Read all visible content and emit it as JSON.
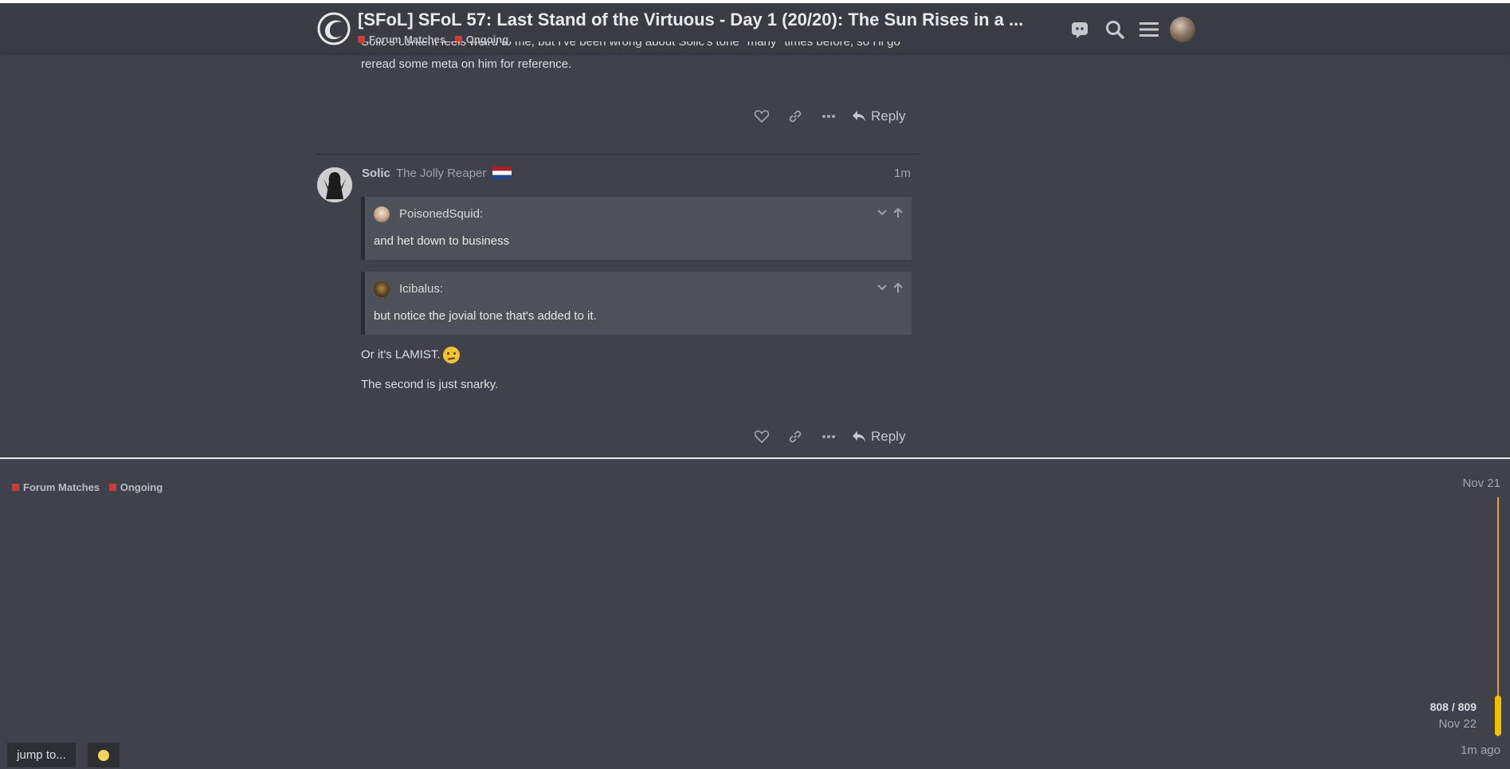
{
  "header": {
    "title": "[SFoL] SFoL 57: Last Stand of the Virtuous - Day 1 (20/20): The Sun Rises in a ...",
    "categories": [
      "Forum Matches",
      "Ongoing"
    ],
    "icons": [
      "discord-icon",
      "search-icon",
      "hamburger-menu-icon",
      "user-avatar"
    ]
  },
  "previous_post": {
    "cut_text": "Solic's content feels weird to me, but I've been wrong about Solic's tone *many* times before, so I'll go",
    "text": "reread some meta on him for reference.",
    "reply_label": "Reply"
  },
  "post": {
    "username": "Solic",
    "user_title": "The Jolly Reaper",
    "time": "1m",
    "quotes": [
      {
        "author": "PoisonedSquid:",
        "text": "and het down to business"
      },
      {
        "author": "Icibalus:",
        "text": "but notice the jovial tone that's added to it."
      }
    ],
    "paragraphs": [
      "Or it's LAMIST.",
      "The second is just snarky."
    ],
    "reply_label": "Reply"
  },
  "footer": {
    "categories": [
      "Forum Matches",
      "Ongoing"
    ],
    "jump_label": "jump to..."
  },
  "timeline": {
    "start_date": "Nov 21",
    "position": "808 / 809",
    "current_date": "Nov 22",
    "last_activity": "1m ago",
    "progress_fraction": 0.9988
  },
  "colors": {
    "category": "#d33838",
    "timeline": "#e0a92c",
    "background": "#3f424a"
  }
}
